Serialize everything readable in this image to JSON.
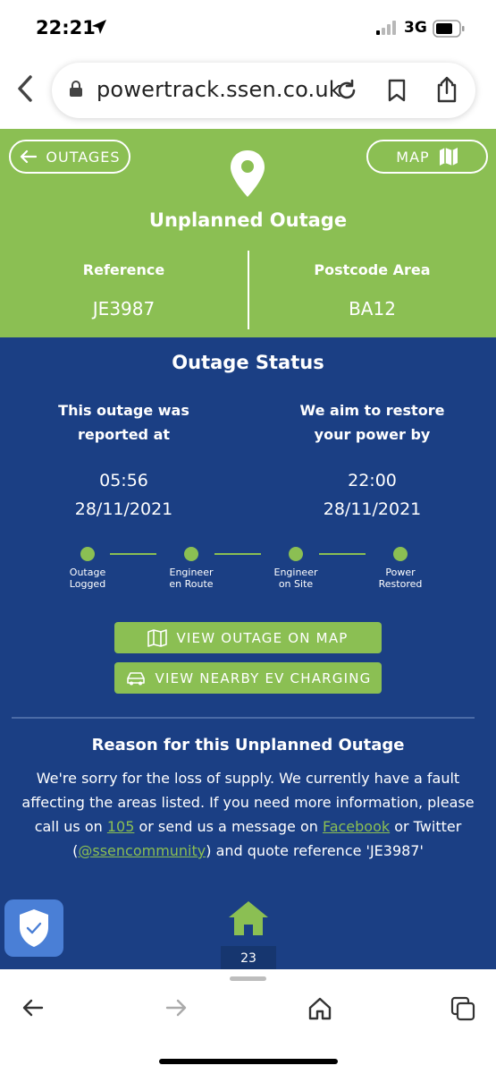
{
  "status_bar": {
    "time": "22:21",
    "network": "3G"
  },
  "browser": {
    "url": "powertrack.ssen.co.uk"
  },
  "header": {
    "outages_button": "OUTAGES",
    "map_button": "MAP",
    "title": "Unplanned Outage",
    "reference_label": "Reference",
    "reference_value": "JE3987",
    "postcode_label": "Postcode Area",
    "postcode_value": "BA12"
  },
  "status": {
    "title": "Outage Status",
    "reported_label_line1": "This outage was",
    "reported_label_line2": "reported at",
    "reported_time": "05:56",
    "reported_date": "28/11/2021",
    "restore_label_line1": "We aim to restore",
    "restore_label_line2": "your power by",
    "restore_time": "22:00",
    "restore_date": "28/11/2021",
    "steps": [
      {
        "line1": "Outage",
        "line2": "Logged"
      },
      {
        "line1": "Engineer",
        "line2": "en Route"
      },
      {
        "line1": "Engineer",
        "line2": "on Site"
      },
      {
        "line1": "Power",
        "line2": "Restored"
      }
    ]
  },
  "actions": {
    "view_map": "VIEW OUTAGE ON MAP",
    "view_ev": "VIEW NEARBY EV CHARGING"
  },
  "reason": {
    "title": "Reason for this Unplanned Outage",
    "text1": "We're sorry for the loss of supply. We currently have a fault affecting the areas listed. If you need more information, please call us on ",
    "phone": "105",
    "text2": " or send us a message on ",
    "facebook": "Facebook",
    "text3": " or Twitter (",
    "twitter": "@ssencommunity",
    "text4": ") and quote reference 'JE3987'"
  },
  "footer": {
    "page_number": "23"
  },
  "colors": {
    "green": "#8bbf53",
    "blue": "#1b3f84"
  }
}
